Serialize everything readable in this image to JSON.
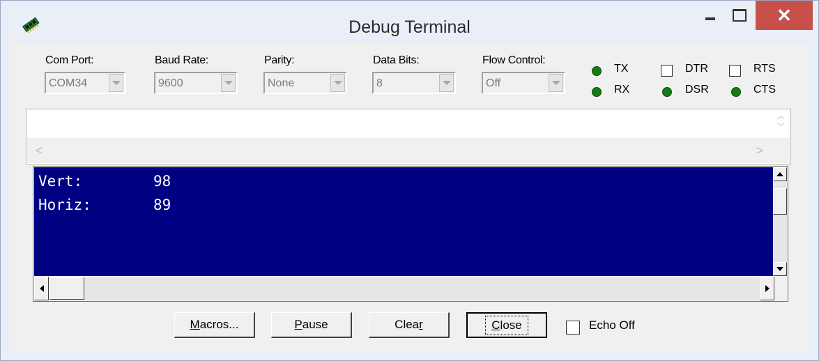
{
  "window": {
    "title": "Debug Terminal",
    "close_glyph": "✕",
    "icon": "chip-icon"
  },
  "settings": {
    "com_port": {
      "label": "Com Port:",
      "value": "COM34"
    },
    "baud_rate": {
      "label": "Baud Rate:",
      "value": "9600"
    },
    "parity": {
      "label": "Parity:",
      "value": "None"
    },
    "data_bits": {
      "label": "Data Bits:",
      "value": "8"
    },
    "flow_control": {
      "label": "Flow Control:",
      "value": "Off"
    }
  },
  "signals": {
    "tx": "TX",
    "rx": "RX",
    "dtr": "DTR",
    "rts": "RTS",
    "dsr": "DSR",
    "cts": "CTS",
    "led_color": "#137d13"
  },
  "receive": {
    "lines": [
      {
        "label": "Vert:",
        "value": "98"
      },
      {
        "label": "Horiz:",
        "value": "89"
      }
    ],
    "bg_color": "#000082"
  },
  "buttons": {
    "macros": {
      "pre": "",
      "key": "M",
      "post": "acros..."
    },
    "pause": {
      "pre": "",
      "key": "P",
      "post": "ause"
    },
    "clear": {
      "pre": "Clea",
      "key": "r",
      "post": ""
    },
    "close": {
      "pre": "",
      "key": "C",
      "post": "lose"
    }
  },
  "echo": {
    "label": "Echo Off",
    "checked": false
  }
}
